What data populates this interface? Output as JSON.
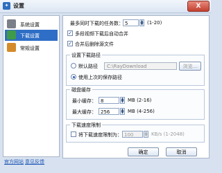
{
  "window": {
    "title": "设置",
    "close_label": "X"
  },
  "sidebar": {
    "items": [
      {
        "label": "系统设置",
        "icon": "system-settings-icon",
        "selected": false
      },
      {
        "label": "下载设置",
        "icon": "download-settings-icon",
        "selected": true
      },
      {
        "label": "常规设置",
        "icon": "general-settings-icon",
        "selected": false
      }
    ]
  },
  "footer": {
    "official_site": "官方网站",
    "feedback": "意见反馈"
  },
  "download": {
    "max_tasks_label": "最多同时下载的任务数：",
    "max_tasks_value": "5",
    "max_tasks_range": "(1-20)",
    "auto_merge_label": "多段视频下载后自动合并",
    "delete_temp_label": "合并后删除源文件"
  },
  "path": {
    "title": "设置下载路径",
    "default_label": "默认路径",
    "default_value": "C:\\RayDownload",
    "browse_label": "浏览...",
    "last_used_label": "使用上次的保存路径"
  },
  "cache": {
    "title": "磁盘缓存",
    "min_label": "最小缓存：",
    "min_value": "8",
    "min_unit": "MB (2-16)",
    "max_label": "最大缓存：",
    "max_value": "256",
    "max_unit": "MB (4-256)"
  },
  "speed": {
    "title": "下载速度限制",
    "limit_label": "将下载速度限制为：",
    "limit_value": "100",
    "limit_unit": "KB/s (1-2048)"
  },
  "buttons": {
    "ok": "确定",
    "cancel": "取消"
  },
  "colors": {
    "selected": "#2f6ec6",
    "window_bg": "#d7e1ef"
  }
}
